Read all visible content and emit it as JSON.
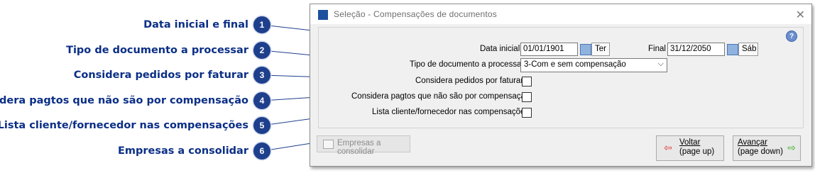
{
  "window": {
    "title": "Seleção - Compensações de documentos",
    "close_glyph": "✕",
    "help_glyph": "?"
  },
  "form": {
    "date_start_label": "Data inicial",
    "date_start_value": "01/01/1901",
    "date_start_day": "Ter",
    "date_end_label": "Final",
    "date_end_value": "31/12/2050",
    "date_end_day": "Sáb",
    "doc_type_label": "Tipo de documento a processar",
    "doc_type_value": "3-Com e sem compensação",
    "pedidos_label": "Considera pedidos por faturar",
    "pagtos_label": "Considera pagtos que não são por compensação",
    "lista_label": "Lista cliente/fornecedor nas compensações"
  },
  "buttons": {
    "empresas": "Empresas a consolidar",
    "voltar_line1": "Voltar",
    "voltar_line2": "(page up)",
    "avancar_line1": "Avançar",
    "avancar_line2": "(page down)"
  },
  "callouts": [
    {
      "number": "1",
      "label": "Data inicial e final"
    },
    {
      "number": "2",
      "label": "Tipo de documento a processar"
    },
    {
      "number": "3",
      "label": "Considera pedidos por faturar"
    },
    {
      "number": "4",
      "label": "Considera pagtos que não são por compensação"
    },
    {
      "number": "5",
      "label": "Lista cliente/fornecedor nas compensações"
    },
    {
      "number": "6",
      "label": "Empresas a consolidar"
    }
  ],
  "colors": {
    "callout_text": "#0b2f86",
    "badge": "#1e3f8c",
    "voltar_arrow": "#e23b3b",
    "avancar_arrow": "#3eae2a"
  }
}
